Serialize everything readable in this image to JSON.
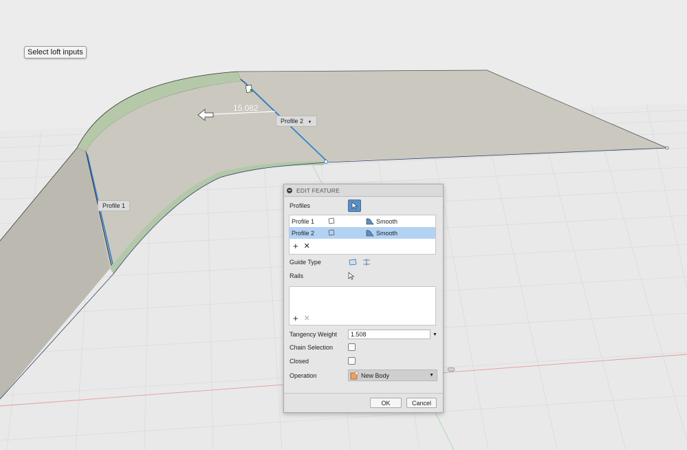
{
  "viewport": {
    "tooltip": "Select loft inputs",
    "profile1_label": "Profile 1",
    "profile2_label": "Profile 2",
    "dimension_value": "15.082",
    "colors": {
      "surface": "#c8c6bc",
      "surface_dark": "#b4b2a8",
      "green_edge": "#b2c8a8",
      "highlight_blue": "#2b7fd6",
      "grid": "#dcdcdc"
    }
  },
  "dialog": {
    "title": "EDIT FEATURE",
    "profiles_label": "Profiles",
    "profiles": [
      {
        "name": "Profile 1",
        "condition": "Smooth"
      },
      {
        "name": "Profile 2",
        "condition": "Smooth"
      }
    ],
    "guide_type_label": "Guide Type",
    "rails_label": "Rails",
    "tangency_weight_label": "Tangency Weight",
    "tangency_weight_value": "1.508",
    "chain_selection_label": "Chain Selection",
    "closed_label": "Closed",
    "operation_label": "Operation",
    "operation_value": "New Body",
    "ok_label": "OK",
    "cancel_label": "Cancel"
  }
}
